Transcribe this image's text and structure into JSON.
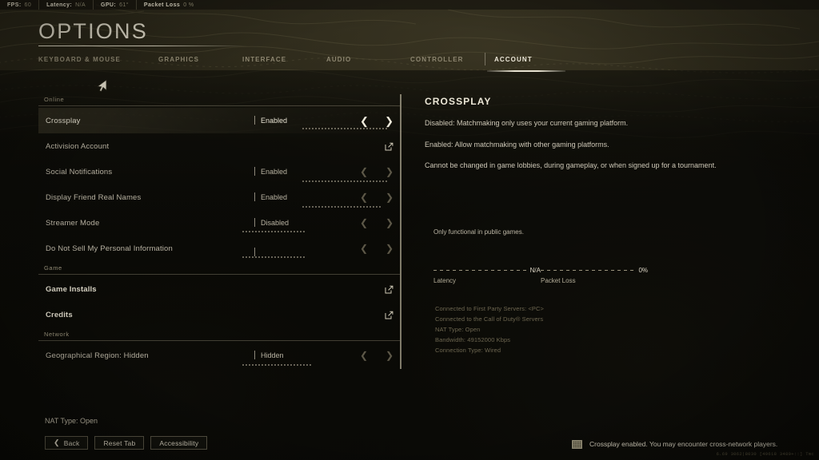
{
  "perf_bar": [
    {
      "key": "FPS:",
      "value": "60"
    },
    {
      "key": "Latency:",
      "value": "N/A"
    },
    {
      "key": "GPU:",
      "value": "61°"
    },
    {
      "key": "Packet Loss",
      "value": "0 %"
    }
  ],
  "header": {
    "title": "OPTIONS"
  },
  "tabs": [
    {
      "label": "KEYBOARD & MOUSE",
      "active": false
    },
    {
      "label": "GRAPHICS",
      "active": false
    },
    {
      "label": "INTERFACE",
      "active": false
    },
    {
      "label": "AUDIO",
      "active": false
    },
    {
      "label": "CONTROLLER",
      "active": false
    },
    {
      "label": "ACCOUNT",
      "active": true
    }
  ],
  "sections": [
    {
      "title": "Online",
      "rows": [
        {
          "label": "Crossplay",
          "value": "Enabled",
          "control": "stepper",
          "selected": true
        },
        {
          "label": "Activision Account",
          "value": "",
          "control": "external",
          "selected": false
        },
        {
          "label": "Social Notifications",
          "value": "Enabled",
          "control": "stepper",
          "selected": false
        },
        {
          "label": "Display Friend Real Names",
          "value": "Enabled",
          "control": "stepper",
          "selected": false
        },
        {
          "label": "Streamer Mode",
          "value": "Disabled",
          "control": "stepper",
          "selected": false
        },
        {
          "label": "Do Not Sell My Personal Information",
          "value": "",
          "control": "stepper",
          "selected": false
        }
      ]
    },
    {
      "title": "Game",
      "rows": [
        {
          "label": "Game Installs",
          "value": "",
          "control": "external",
          "selected": false,
          "strong": true
        },
        {
          "label": "Credits",
          "value": "",
          "control": "external",
          "selected": false,
          "strong": true
        }
      ]
    },
    {
      "title": "Network",
      "rows": [
        {
          "label": "Geographical Region: Hidden",
          "value": "Hidden",
          "control": "stepper",
          "selected": false
        }
      ]
    }
  ],
  "detail": {
    "title": "CROSSPLAY",
    "paragraphs": [
      "Disabled: Matchmaking only uses your current gaming platform.",
      "Enabled: Allow matchmaking with other gaming platforms.",
      "Cannot be changed in game lobbies, during gameplay, or when signed up for a tournament."
    ],
    "public_note": "Only functional in public games."
  },
  "network_stats": [
    {
      "label": "Latency",
      "value": "N/A"
    },
    {
      "label": "Packet Loss",
      "value": "0%"
    }
  ],
  "connection_info": [
    "Connected to First Party Servers: <PC>",
    "Connected to the Call of Duty® Servers",
    "NAT Type: Open",
    "Bandwidth: 49152000 Kbps",
    "Connection Type: Wired"
  ],
  "footer": {
    "nat_line": "NAT Type: Open",
    "buttons": [
      {
        "label": "Back",
        "icon": "chevron-left-icon"
      },
      {
        "label": "Reset Tab",
        "icon": ""
      },
      {
        "label": "Accessibility",
        "icon": ""
      }
    ],
    "toast": {
      "icon": "crossplay-icon",
      "text": "Crossplay enabled. You may encounter cross-network players."
    },
    "build": "6.69 3062|8030 [49618 3480+::] Tmc"
  },
  "icons": {
    "external_link": "external-link-icon",
    "arrow_left": "◀",
    "arrow_right": "▶",
    "chevron_left": "❮"
  },
  "colors": {
    "background": "#12110c",
    "panel_dark": "#0d0c08",
    "text_primary": "#ddd8c8",
    "text_secondary": "#b6b0a0",
    "text_muted": "#6d6650",
    "accent": "#e8e3d2",
    "rule": "#968f78"
  }
}
